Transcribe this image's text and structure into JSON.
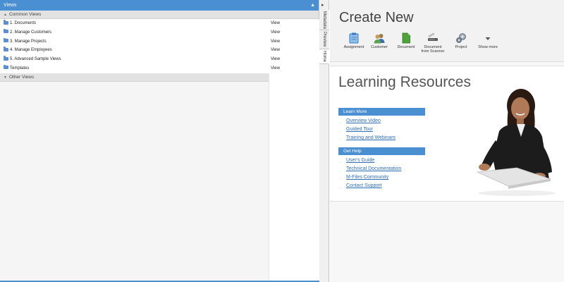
{
  "views_panel": {
    "title": "Views",
    "collapse_icon": "chevron-up-icon",
    "groups": [
      {
        "label": "Common Views"
      },
      {
        "label": "Other Views"
      }
    ],
    "items": [
      {
        "name": "1. Documents",
        "type": "View"
      },
      {
        "name": "2. Manage Customers",
        "type": "View"
      },
      {
        "name": "3. Manage Projects",
        "type": "View"
      },
      {
        "name": "4. Manage Employees",
        "type": "View"
      },
      {
        "name": "5. Advanced Sample Views",
        "type": "View"
      },
      {
        "name": "Templates",
        "type": "View"
      }
    ]
  },
  "side_tabs": [
    {
      "label": "Metadata"
    },
    {
      "label": "Preview"
    },
    {
      "label": "Home"
    }
  ],
  "create_new": {
    "title": "Create New",
    "buttons": [
      {
        "label": "Assignment",
        "icon": "assignment-icon"
      },
      {
        "label": "Customer",
        "icon": "customer-icon"
      },
      {
        "label": "Document",
        "icon": "document-icon"
      },
      {
        "label": "Document",
        "label2": "from Scanner",
        "icon": "scanner-icon"
      },
      {
        "label": "Project",
        "icon": "project-icon"
      },
      {
        "label": "Show more",
        "icon": "chevron-down-icon"
      }
    ]
  },
  "learning": {
    "title": "Learning Resources",
    "learn_more": {
      "label": "Learn More",
      "links": [
        "Overview Video",
        "Guided Tour",
        "Training and Webinars"
      ]
    },
    "get_help": {
      "label": "Get Help",
      "links": [
        "User's Guide",
        "Technical Documentation",
        "M-Files Community",
        "Contact Support"
      ]
    }
  },
  "colors": {
    "accent": "#4a8fd1",
    "link": "#2f6fb8"
  }
}
